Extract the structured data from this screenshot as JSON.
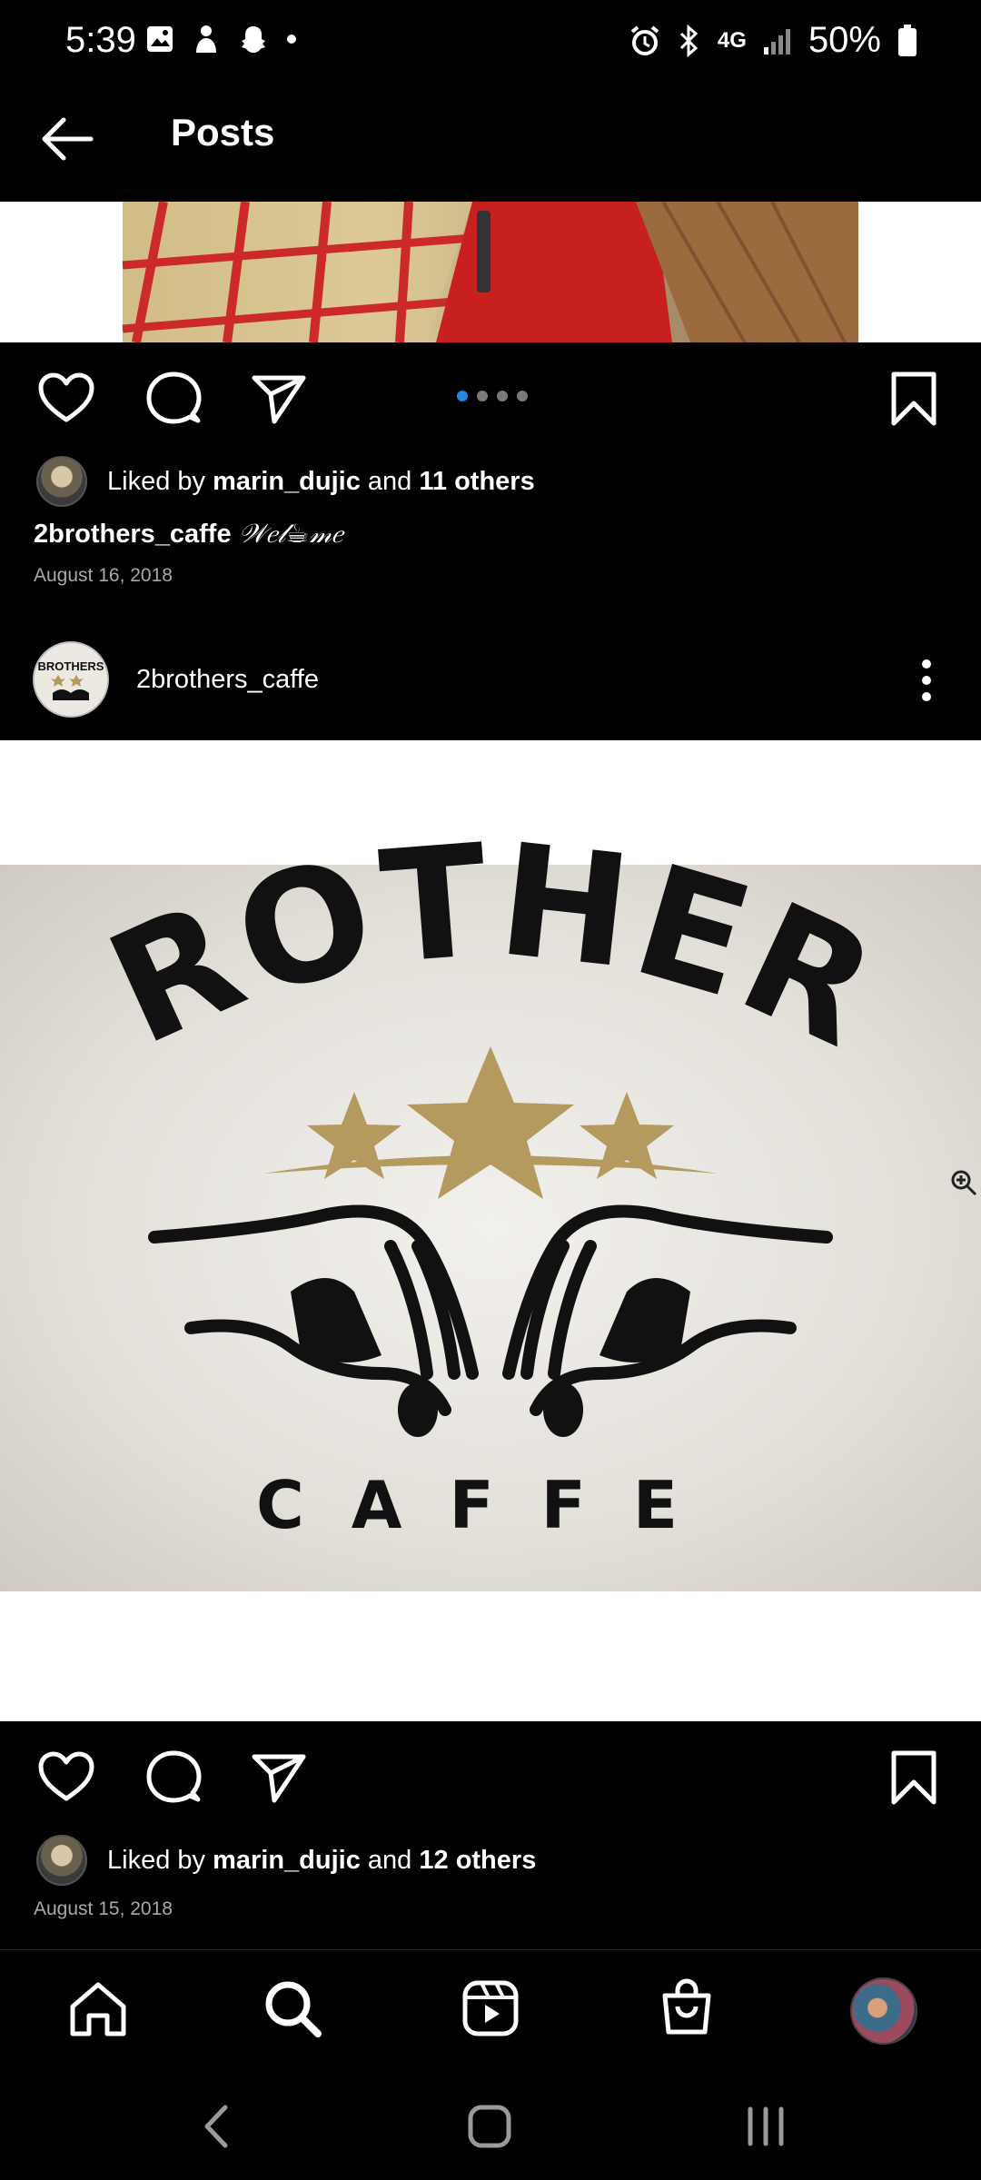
{
  "status_bar": {
    "time": "5:39",
    "battery": "50%",
    "network": "4G"
  },
  "header": {
    "title": "Posts"
  },
  "post1": {
    "likes": {
      "prefix": "Liked by",
      "user": "marin_dujic",
      "and": "and",
      "others": "11 others"
    },
    "caption": {
      "username": "2brothers_caffe",
      "text": "𝒲𝑒𝓁☕𝓂𝑒"
    },
    "date": "August 16, 2018",
    "carousel_pages": 4,
    "carousel_active": 1
  },
  "post2": {
    "author": "2brothers_caffe",
    "image_text": {
      "top": "BROTHERS",
      "bottom": "CAFFE",
      "avatar_label": "BROTHERS"
    },
    "likes": {
      "prefix": "Liked by",
      "user": "marin_dujic",
      "and": "and",
      "others": "12 others"
    },
    "date": "August 15, 2018"
  },
  "icons": {
    "like": "heart-icon",
    "comment": "comment-icon",
    "share": "send-icon",
    "save": "bookmark-icon",
    "more": "more-vertical-icon",
    "zoom": "zoom-in-icon"
  },
  "bottom_nav": [
    "home",
    "search",
    "reels",
    "shop",
    "profile"
  ],
  "colors": {
    "background": "#000000",
    "accent": "#1e88e5",
    "logo_gold": "#b49a5e"
  }
}
